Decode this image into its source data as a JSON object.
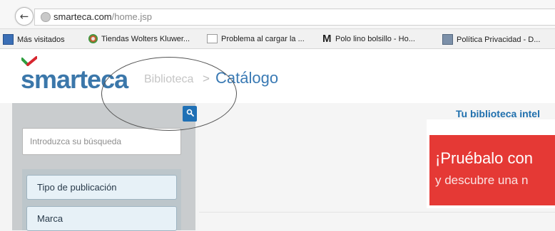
{
  "browser": {
    "url_host": "smarteca.com",
    "url_path": "/home.jsp",
    "icons": {
      "back": "back-arrow-icon",
      "site": "globe-icon"
    }
  },
  "bookmarks": [
    {
      "label": "Más visitados",
      "icon": "bookmark-folder-icon"
    },
    {
      "label": "Tiendas Wolters Kluwer...",
      "icon": "site-favicon"
    },
    {
      "label": "Problema al cargar la ...",
      "icon": "page-icon"
    },
    {
      "label": "Polo lino bolsillo - Ho...",
      "icon": "m-favicon",
      "glyph": "M"
    },
    {
      "label": "Política Privacidad - D...",
      "icon": "bin-favicon"
    }
  ],
  "header": {
    "logo": "smarteca",
    "breadcrumb_parent": "Biblioteca",
    "breadcrumb_sep": ">",
    "breadcrumb_current": "Catálogo"
  },
  "sidebar": {
    "search_placeholder": "Introduzca su búsqueda",
    "filters": [
      "Tipo de publicación",
      "Marca"
    ]
  },
  "main": {
    "tagline": "Tu biblioteca intel",
    "promo_title": "¡Pruébalo con",
    "promo_sub": "y descubre una n"
  },
  "colors": {
    "brand_blue": "#3b77aa",
    "logo_green": "#2e9e3f",
    "logo_red": "#d7262f",
    "promo_red": "#e53935",
    "search_button": "#1f70b5"
  }
}
